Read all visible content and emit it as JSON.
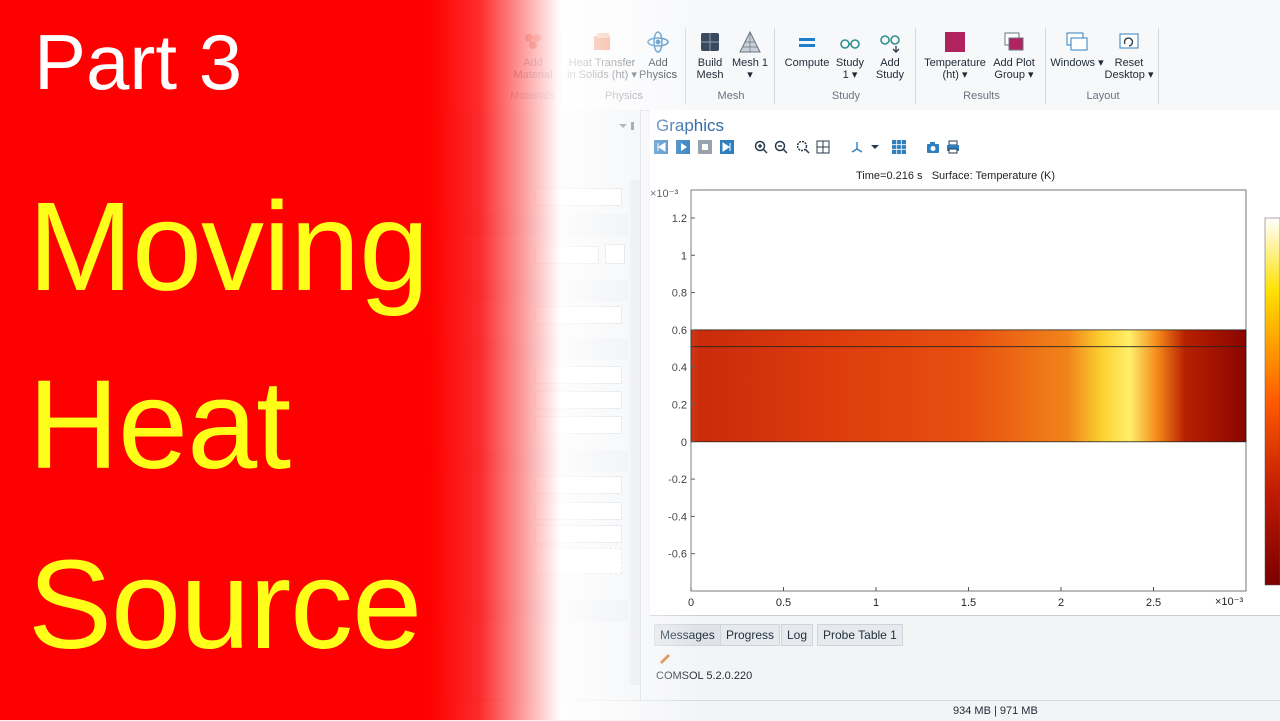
{
  "ribbon": {
    "materials": {
      "label": "Materials",
      "add_material": "Add Material"
    },
    "physics": {
      "label": "Physics",
      "heat_transfer": "Heat Transfer in Solids (ht) ▾",
      "add_physics": "Add Physics"
    },
    "mesh": {
      "label": "Mesh",
      "build_mesh": "Build Mesh",
      "mesh1": "Mesh 1 ▾"
    },
    "study": {
      "label": "Study",
      "compute": "Compute",
      "study1": "Study 1 ▾",
      "add_study": "Add Study"
    },
    "results": {
      "label": "Results",
      "temperature": "Temperature (ht) ▾",
      "add_plot_group": "Add Plot Group ▾"
    },
    "layout": {
      "label": "Layout",
      "windows": "Windows ▾",
      "reset_desktop": "Reset Desktop ▾"
    }
  },
  "graphics": {
    "title": "Graphics",
    "caption": "Time=0.216 s   Surface: Temperature (K)"
  },
  "chart_data": {
    "type": "heatmap",
    "title": "Time=0.216 s   Surface: Temperature (K)",
    "x_multiplier": "×10⁻³",
    "y_multiplier": "×10⁻³",
    "xlim": [
      0,
      3
    ],
    "ylim": [
      -0.8,
      1.35
    ],
    "x_ticks": [
      "0",
      "0.5",
      "1",
      "1.5",
      "2",
      "2.5"
    ],
    "x_tick_values": [
      0,
      0.5,
      1,
      1.5,
      2,
      2.5
    ],
    "y_ticks": [
      "1.2",
      "1",
      "0.8",
      "0.6",
      "0.4",
      "0.2",
      "0",
      "-0.2",
      "-0.4",
      "-0.6"
    ],
    "y_tick_values": [
      1.2,
      1.0,
      0.8,
      0.6,
      0.4,
      0.2,
      0,
      -0.2,
      -0.4,
      -0.6
    ],
    "domain_rect": {
      "x0": 0,
      "x1": 3,
      "y0": 0,
      "y1": 0.6
    },
    "inner_line_y": 0.51,
    "hot_spot_x": 2.15,
    "colormap": [
      "#7a0000",
      "#c01a00",
      "#ff5a00",
      "#ffe000",
      "#ffffff"
    ]
  },
  "messages": {
    "tabs": [
      "Messages",
      "Progress",
      "Log",
      "Probe Table 1"
    ],
    "line1": "COMSOL 5.2.0.220"
  },
  "status": {
    "memory": "934 MB | 971 MB"
  },
  "thumbnail": {
    "part": "Part 3",
    "line1": "Moving",
    "line2": "Heat",
    "line3": "Source"
  }
}
